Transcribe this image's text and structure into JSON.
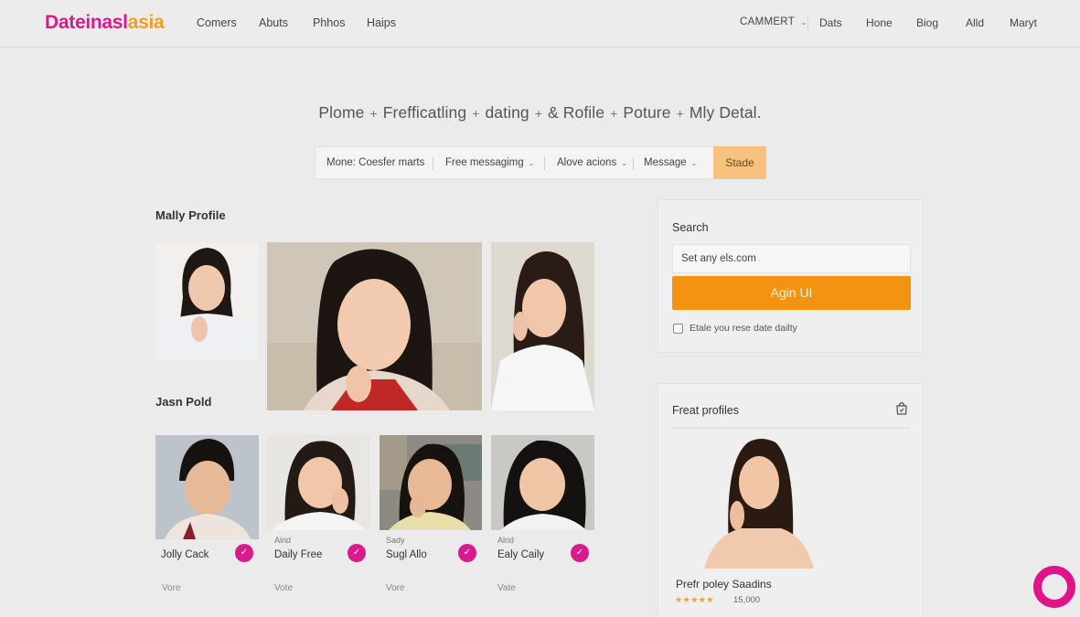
{
  "brand": {
    "part1": "Dateinasl",
    "part2": "asia",
    "accent": "#d81b8c",
    "accent2": "#f0a020"
  },
  "nav_left": [
    "Comers",
    "Abuts",
    "Phhos",
    "Haips"
  ],
  "nav_right": {
    "dropdown": "CAMMERT",
    "items": [
      "Dats",
      "Hone",
      "Biog",
      "Alld",
      "Maryt"
    ]
  },
  "breadcrumb": [
    "Plome",
    "Frefficatling",
    "dating",
    "& Rofile",
    "Poture",
    "Mly Detal."
  ],
  "filters": {
    "items": [
      "Mone: Coesfer marts",
      "Free messagimg",
      "Alove acions",
      "Message"
    ],
    "button": "Stade",
    "button_color": "#f6c27e"
  },
  "sections": {
    "profile": "Mally Profile",
    "second": "Jasn Pold"
  },
  "cards": [
    {
      "small": "",
      "name": "Jolly Cack",
      "vote": "Vore"
    },
    {
      "small": "Alrid",
      "name": "Daily Free",
      "vote": "Vote"
    },
    {
      "small": "Sady",
      "name": "Sugl Allo",
      "vote": "Vore"
    },
    {
      "small": "Alrid",
      "name": "Ealy Caily",
      "vote": "Vate"
    }
  ],
  "search_panel": {
    "title": "Search",
    "input_value": "Set any els.com",
    "button": "Agin UI",
    "button_color": "#f49312",
    "checkbox_label": "Etale you rese date dailty"
  },
  "featured": {
    "title": "Freat profiles",
    "name": "Prefr poley Saadins",
    "stars": "★★★★★",
    "rating_count": "15,000"
  },
  "icons": {
    "chevron": "chevron-down-icon",
    "check": "check-icon",
    "bag": "bag-icon",
    "fab": "ring-icon"
  }
}
